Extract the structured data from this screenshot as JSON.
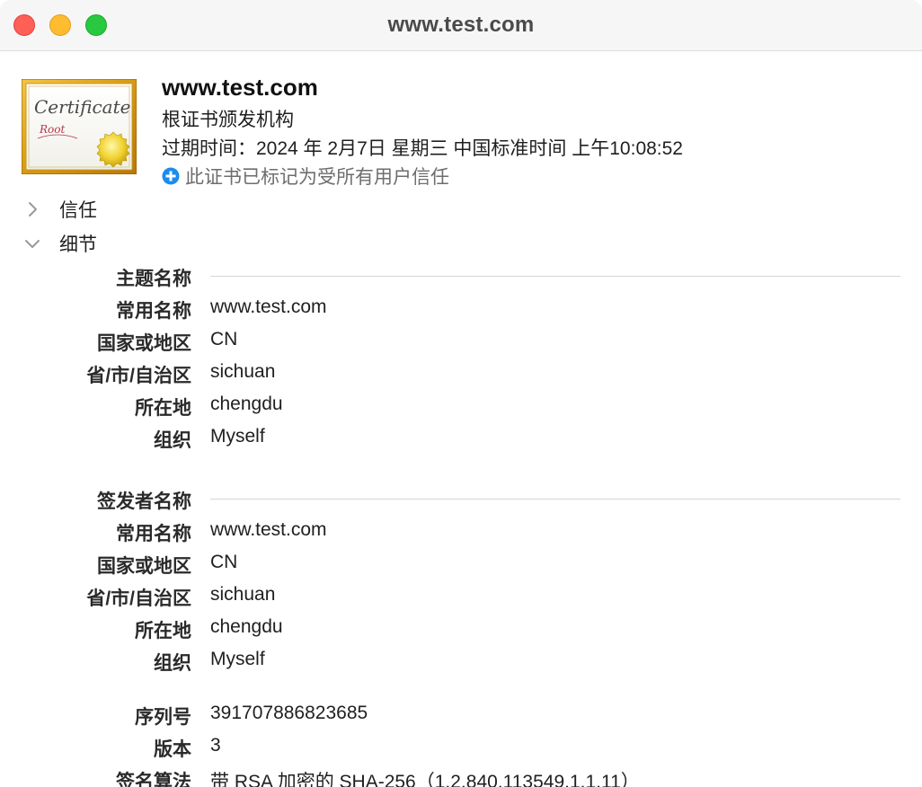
{
  "window": {
    "title": "www.test.com"
  },
  "header": {
    "icon": "certificate-icon",
    "icon_text_main": "Certificate",
    "icon_text_sub": "Root",
    "name": "www.test.com",
    "kind": "根证书颁发机构",
    "expiry": "过期时间：2024 年 2月7日 星期三 中国标准时间 上午10:08:52",
    "trust_status": "此证书已标记为受所有用户信任",
    "trust_icon": "plus-circle-icon",
    "trust_icon_color": "#1a8cf0"
  },
  "sections": {
    "trust": {
      "label": "信任",
      "expanded": false
    },
    "details": {
      "label": "细节",
      "expanded": true
    }
  },
  "details": {
    "subject": {
      "heading": "主题名称",
      "rows": [
        {
          "label": "常用名称",
          "value": "www.test.com"
        },
        {
          "label": "国家或地区",
          "value": "CN"
        },
        {
          "label": "省/市/自治区",
          "value": "sichuan"
        },
        {
          "label": "所在地",
          "value": "chengdu"
        },
        {
          "label": "组织",
          "value": "Myself"
        }
      ]
    },
    "issuer": {
      "heading": "签发者名称",
      "rows": [
        {
          "label": "常用名称",
          "value": "www.test.com"
        },
        {
          "label": "国家或地区",
          "value": "CN"
        },
        {
          "label": "省/市/自治区",
          "value": "sichuan"
        },
        {
          "label": "所在地",
          "value": "chengdu"
        },
        {
          "label": "组织",
          "value": "Myself"
        }
      ]
    },
    "misc": {
      "rows": [
        {
          "label": "序列号",
          "value": "391707886823685"
        },
        {
          "label": "版本",
          "value": "3"
        },
        {
          "label": "签名算法",
          "value": "带 RSA 加密的 SHA-256（1.2.840.113549.1.1.11）"
        }
      ]
    }
  }
}
